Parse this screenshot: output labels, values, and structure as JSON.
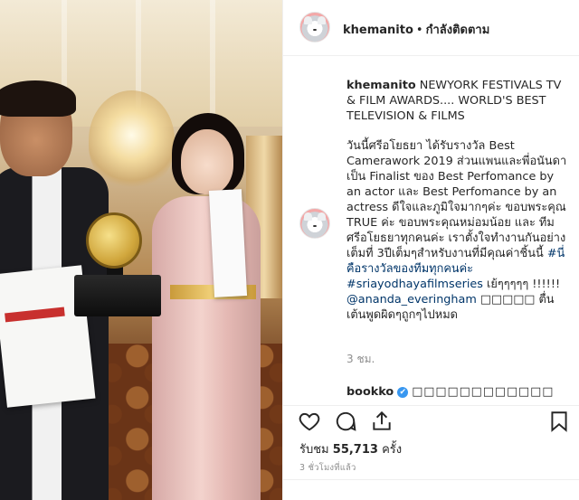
{
  "header": {
    "username": "khemanito",
    "separator": "•",
    "follow_status": "กำลังติดตาม"
  },
  "caption": {
    "username": "khemanito",
    "line1": "NEWYORK FESTIVALS TV & FILM AWARDS.... WORLD'S BEST TELEVISION & FILMS",
    "body_text": "วันนี้ศรีอโยธยา ได้รับรางวัล Best Camerawork 2019 ส่วนแพนและพี่อนันดา เป็น Finalist ของ Best Perfomance by an actor และ Best Perfomance by an actress ดีใจและภูมิใจมากๆค่ะ ขอบพระคุณ TRUE ค่ะ ขอบพระคุณหม่อมน้อย และ ทีม ศรีอโยธยาทุกคนค่ะ เราตั้งใจทำงานกันอย่างเต็มที่ 3ปีเต็มๆสำหรับงานที่มีคุณค่าชิ้นนี้",
    "hashtag1": "#นี่คือรางวัลของทีมทุกคนค่ะ",
    "hashtag2": "#sriayodhayafilmseries",
    "after_hashtags": " เย้ๆๆๆๆๆ !!!!!! ",
    "mention": "@ananda_everingham",
    "boxes": " □□□□□",
    "tail": "ตื่นเต้นพูดผิดๆถูกๆไปหมด",
    "timestamp": "3 ชม."
  },
  "comment": {
    "username": "bookko",
    "verified_mark": "✔",
    "text": "□□□□□□□□□□□□"
  },
  "actions": {
    "like_icon": "heart-icon",
    "comment_icon": "comment-icon",
    "share_icon": "share-icon",
    "save_icon": "bookmark-icon"
  },
  "likes": {
    "prefix": "รับชม",
    "count": "55,713",
    "suffix": "ครั้ง"
  },
  "post_time": "3 ชั่วโมงที่แล้ว",
  "colors": {
    "link": "#003569",
    "muted": "#8e8e8e",
    "verified": "#3897f0",
    "border": "#efefef"
  }
}
